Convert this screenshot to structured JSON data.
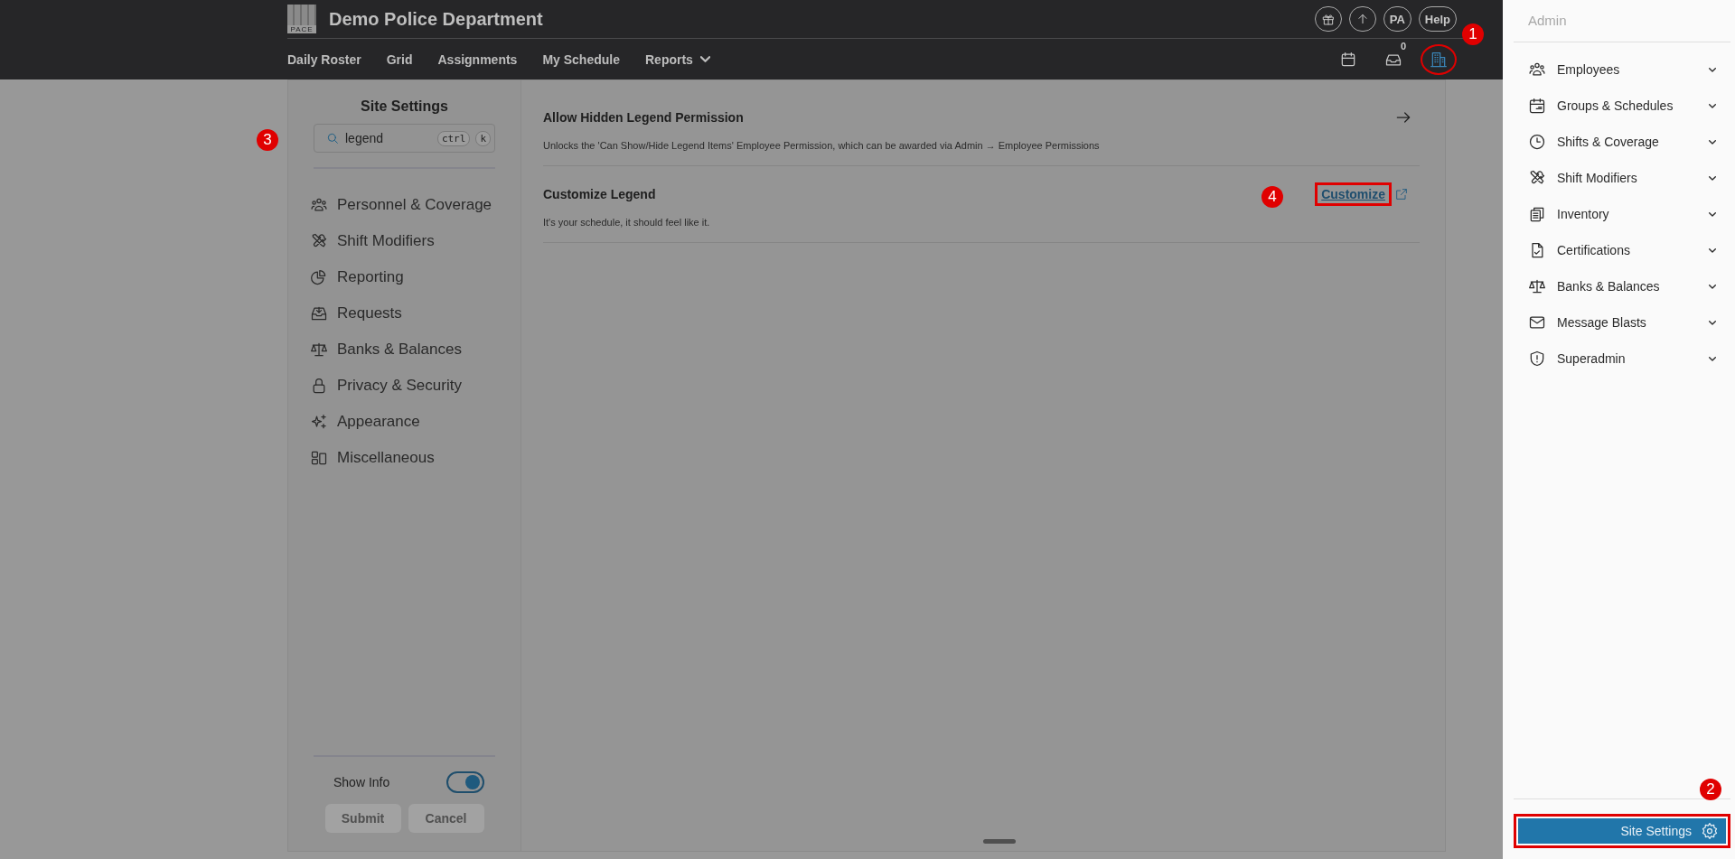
{
  "header": {
    "logo_text": "PACE",
    "title": "Demo Police Department",
    "account_buttons": [
      {
        "kind": "gift"
      },
      {
        "kind": "upload"
      },
      {
        "kind": "text",
        "label": "PA"
      },
      {
        "kind": "text",
        "label": "Help"
      }
    ],
    "nav": [
      {
        "label": "Daily Roster",
        "has_menu": false
      },
      {
        "label": "Grid",
        "has_menu": false
      },
      {
        "label": "Assignments",
        "has_menu": false
      },
      {
        "label": "My Schedule",
        "has_menu": false
      },
      {
        "label": "Reports",
        "has_menu": true
      }
    ],
    "toolbar_icons": [
      {
        "kind": "calendar",
        "selected": false,
        "highlighted": false
      },
      {
        "kind": "inbox",
        "badge": "0",
        "selected": false,
        "highlighted": false
      },
      {
        "kind": "building",
        "selected": true,
        "highlighted": true
      }
    ]
  },
  "settings_panel": {
    "title": "Site Settings",
    "search": {
      "value": "legend",
      "shortcut_keys": [
        "ctrl",
        "k"
      ]
    },
    "categories": [
      {
        "label": "Personnel & Coverage"
      },
      {
        "label": "Shift Modifiers"
      },
      {
        "label": "Reporting"
      },
      {
        "label": "Requests"
      },
      {
        "label": "Banks & Balances"
      },
      {
        "label": "Privacy & Security"
      },
      {
        "label": "Appearance"
      },
      {
        "label": "Miscellaneous"
      }
    ],
    "show_info": {
      "label": "Show Info",
      "on": true
    },
    "buttons": [
      {
        "label": "Submit",
        "disabled": true
      },
      {
        "label": "Cancel",
        "disabled": true
      }
    ]
  },
  "settings": [
    {
      "kind": "navigate",
      "title": "Allow Hidden Legend Permission",
      "description": "Unlocks the 'Can Show/Hide Legend Items' Employee Permission, which can be awarded via Admin → Employee Permissions"
    },
    {
      "kind": "link",
      "title": "Customize Legend",
      "description": "It's your schedule, it should feel like it.",
      "link_label": "Customize",
      "highlighted": true
    }
  ],
  "admin_sidebar": {
    "title": "Admin",
    "items": [
      {
        "label": "Employees",
        "expanded": false
      },
      {
        "label": "Groups & Schedules",
        "expanded": false
      },
      {
        "label": "Shifts & Coverage",
        "expanded": false
      },
      {
        "label": "Shift Modifiers",
        "expanded": false
      },
      {
        "label": "Inventory",
        "expanded": false
      },
      {
        "label": "Certifications",
        "expanded": false
      },
      {
        "label": "Banks & Balances",
        "expanded": false
      },
      {
        "label": "Message Blasts",
        "expanded": false
      },
      {
        "label": "Superadmin",
        "expanded": false
      }
    ],
    "footer_button": {
      "label": "Site Settings",
      "highlighted": true
    }
  },
  "annotations": [
    {
      "label": "1"
    },
    {
      "label": "2"
    },
    {
      "label": "3"
    },
    {
      "label": "4"
    }
  ]
}
